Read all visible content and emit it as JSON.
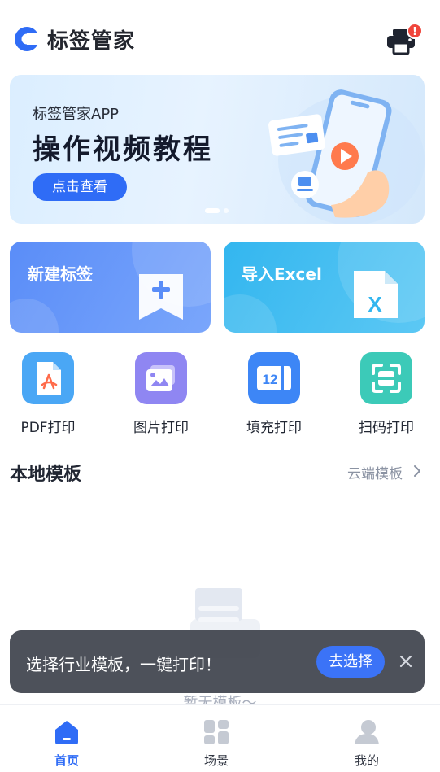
{
  "header": {
    "app_name": "标签管家",
    "alert_badge": "!"
  },
  "banner": {
    "subtitle": "标签管家APP",
    "title": "操作视频教程",
    "button_label": "点击查看",
    "pages": 2,
    "active_page": 1
  },
  "cards": {
    "new_label": "新建标签",
    "import_excel": "导入Excel",
    "excel_icon_letter": "X"
  },
  "tools": [
    {
      "label": "PDF打印",
      "icon": "pdf-file-icon"
    },
    {
      "label": "图片打印",
      "icon": "image-icon"
    },
    {
      "label": "填充打印",
      "icon": "fill-print-icon",
      "icon_text": "12"
    },
    {
      "label": "扫码打印",
      "icon": "scan-icon"
    }
  ],
  "section": {
    "title": "本地模板",
    "cloud_link": "云端模板"
  },
  "empty_state": {
    "text": "暂无模板～"
  },
  "toast": {
    "text": "选择行业模板，一键打印！",
    "button_label": "去选择"
  },
  "tabbar": {
    "items": [
      {
        "label": "首页",
        "icon": "home-icon",
        "active": true
      },
      {
        "label": "场景",
        "icon": "grid-icon",
        "active": false
      },
      {
        "label": "我的",
        "icon": "profile-icon",
        "active": false
      }
    ]
  },
  "colors": {
    "primary": "#2f6cf6",
    "card_new": "#5a8df8",
    "card_excel": "#33b6ef",
    "alert": "#f0463c"
  }
}
